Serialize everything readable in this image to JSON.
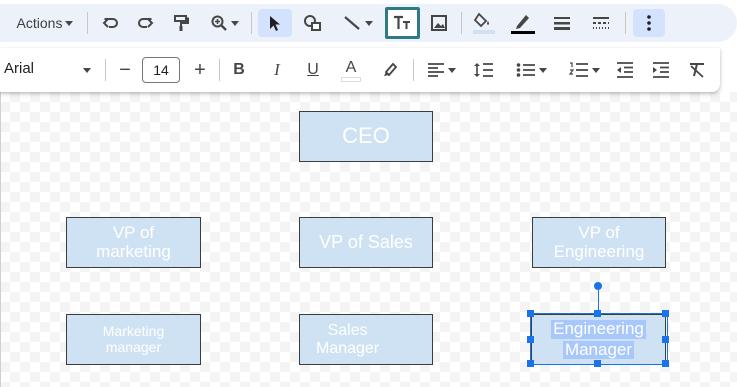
{
  "toolbar": {
    "actions_label": "Actions",
    "buttons": [
      {
        "name": "undo-icon"
      },
      {
        "name": "redo-icon"
      },
      {
        "name": "paint-format-icon"
      },
      {
        "name": "zoom-icon"
      },
      {
        "name": "select-icon"
      },
      {
        "name": "shape-icon"
      },
      {
        "name": "line-icon"
      },
      {
        "name": "text-box-icon"
      },
      {
        "name": "image-icon"
      },
      {
        "name": "fill-color-icon"
      },
      {
        "name": "border-color-icon"
      },
      {
        "name": "border-weight-icon"
      },
      {
        "name": "border-dash-icon"
      },
      {
        "name": "more-options-icon"
      }
    ],
    "active_tool": "select",
    "outlined_tool": "text-box",
    "accent_color": "#d3e3fd",
    "outline_color": "#2e7b86"
  },
  "format_bar": {
    "font_name": "Arial",
    "font_size": "14",
    "decrease_label": "−",
    "increase_label": "+",
    "bold": "B",
    "italic": "I",
    "underline": "U",
    "text_color": "A"
  },
  "chart": {
    "boxes": [
      {
        "id": "ceo",
        "text": "CEO"
      },
      {
        "id": "vp-marketing",
        "text": "VP of\nmarketing"
      },
      {
        "id": "vp-sales",
        "text": "VP of Sales"
      },
      {
        "id": "vp-engineering",
        "text": "VP of\nEngineering"
      },
      {
        "id": "marketing-manager",
        "text": "Marketing\nmanager"
      },
      {
        "id": "sales-manager",
        "text": "Sales\nManager"
      },
      {
        "id": "engineering-manager-line1",
        "text": "Engineering"
      },
      {
        "id": "engineering-manager-line2",
        "text": "Manager"
      }
    ],
    "box_fill": "#cfe2f3",
    "selection_color": "#1a73e8"
  }
}
